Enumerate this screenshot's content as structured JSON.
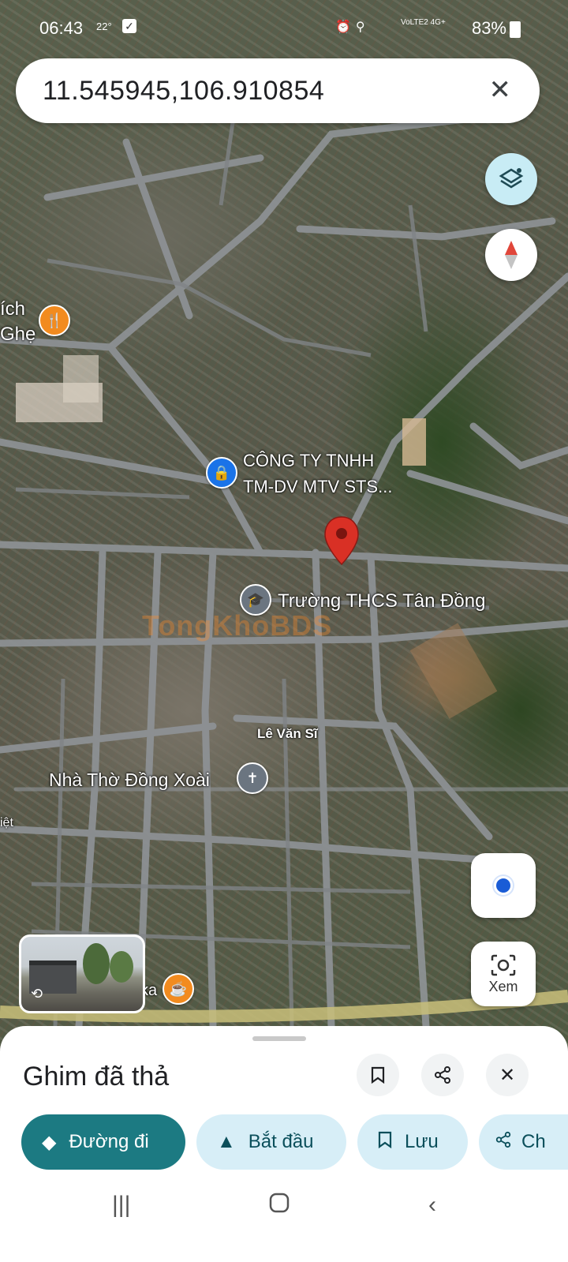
{
  "status_bar": {
    "time": "06:43",
    "temperature": "22°",
    "network": "VoLTE2 4G+",
    "battery": "83%"
  },
  "search": {
    "value": "11.545945,106.910854",
    "clear_icon": "close-icon"
  },
  "map": {
    "labels": {
      "restaurant_partial_1": "ích",
      "restaurant_partial_2": "Ghẹ",
      "company_line1": "CÔNG TY TNHH",
      "company_line2": "TM-DV MTV STS...",
      "school": "Trường THCS Tân Đồng",
      "street": "Lê Văn Sĩ",
      "church": "Nhà Thờ Đồng Xoài",
      "left_edge": "iệt",
      "cafe_partial": "ka"
    },
    "watermark": "TongKhoBDS",
    "pin_color": "#d93025"
  },
  "controls": {
    "layers_icon": "layers-icon",
    "compass_icon": "compass-icon",
    "locate_icon": "my-location-icon",
    "lens_label": "Xem"
  },
  "sheet": {
    "title": "Ghim đã thả",
    "actions": {
      "bookmark_icon": "bookmark-icon",
      "share_icon": "share-icon",
      "close_icon": "close-icon"
    },
    "chips": [
      {
        "label": "Đường đi",
        "icon": "directions-icon"
      },
      {
        "label": "Bắt đầu",
        "icon": "navigation-icon"
      },
      {
        "label": "Lưu",
        "icon": "bookmark-icon"
      },
      {
        "label": "Ch",
        "icon": "share-icon"
      }
    ]
  },
  "colors": {
    "primary_chip": "#1c7a82",
    "secondary_chip": "#d7eef7",
    "pin": "#d93025"
  }
}
